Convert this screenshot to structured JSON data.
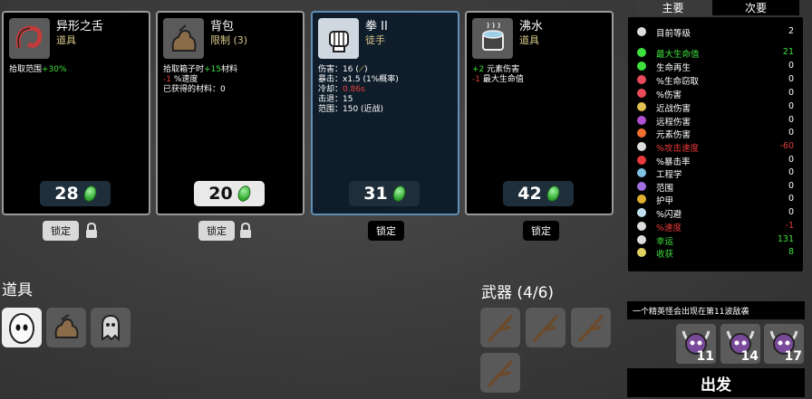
{
  "cards": [
    {
      "name": "异形之舌",
      "type": "道具",
      "lines": [
        {
          "parts": [
            {
              "t": "拾取范围",
              "c": "w"
            },
            {
              "t": "+30%",
              "c": "g"
            }
          ]
        }
      ],
      "price": "28",
      "price_style": "dark",
      "lock": "锁定",
      "lock_style": "light",
      "padlock": true
    },
    {
      "name": "背包",
      "type": "限制 (3)",
      "lines": [
        {
          "parts": [
            {
              "t": "拾取箱子时",
              "c": "w"
            },
            {
              "t": "+15",
              "c": "g"
            },
            {
              "t": "材料",
              "c": "w"
            }
          ]
        },
        {
          "parts": [
            {
              "t": "-1",
              "c": "r"
            },
            {
              "t": " %速度",
              "c": "w"
            }
          ]
        },
        {
          "parts": [
            {
              "t": "已获得的材料：0",
              "c": "w"
            }
          ]
        }
      ],
      "price": "20",
      "price_style": "light",
      "lock": "锁定",
      "lock_style": "light",
      "padlock": true
    },
    {
      "name": "拳 II",
      "type": "徒手",
      "lines": [
        {
          "parts": [
            {
              "t": "伤害：16 (",
              "c": "w"
            },
            {
              "t": "⟋",
              "c": "y"
            },
            {
              "t": ")",
              "c": "w"
            }
          ]
        },
        {
          "parts": [
            {
              "t": "暴击：x1.5 (1%概率)",
              "c": "w"
            }
          ]
        },
        {
          "parts": [
            {
              "t": "冷却：",
              "c": "w"
            },
            {
              "t": "0.86s",
              "c": "r"
            }
          ]
        },
        {
          "parts": [
            {
              "t": "击退：15",
              "c": "w"
            }
          ]
        },
        {
          "parts": [
            {
              "t": "范围：150 (近战)",
              "c": "w"
            }
          ]
        }
      ],
      "price": "31",
      "price_style": "dark",
      "lock": "锁定",
      "lock_style": "black",
      "padlock": false
    },
    {
      "name": "沸水",
      "type": "道具",
      "lines": [
        {
          "parts": [
            {
              "t": "+2",
              "c": "g"
            },
            {
              "t": " 元素伤害",
              "c": "w"
            }
          ]
        },
        {
          "parts": [
            {
              "t": "-1",
              "c": "r"
            },
            {
              "t": " 最大生命值",
              "c": "w"
            }
          ]
        }
      ],
      "price": "42",
      "price_style": "dark",
      "lock": "锁定",
      "lock_style": "black",
      "padlock": false
    }
  ],
  "items_title": "道具",
  "weapons_title": "武器 (4/6)",
  "tabs": {
    "primary": "主要",
    "secondary": "次要"
  },
  "stats": [
    {
      "label": "目前等级",
      "value": "2",
      "color": "w",
      "icon": "level-icon"
    },
    {
      "label": "最大生命值",
      "value": "21",
      "color": "g",
      "icon": "heart-icon"
    },
    {
      "label": "生命再生",
      "value": "0",
      "color": "w",
      "icon": "regen-icon"
    },
    {
      "label": "%生命窃取",
      "value": "0",
      "color": "w",
      "icon": "lifesteal-icon"
    },
    {
      "label": "%伤害",
      "value": "0",
      "color": "w",
      "icon": "damage-icon"
    },
    {
      "label": "近战伤害",
      "value": "0",
      "color": "w",
      "icon": "melee-icon"
    },
    {
      "label": "远程伤害",
      "value": "0",
      "color": "w",
      "icon": "ranged-icon"
    },
    {
      "label": "元素伤害",
      "value": "0",
      "color": "w",
      "icon": "elemental-icon"
    },
    {
      "label": "%攻击速度",
      "value": "-60",
      "color": "r",
      "icon": "attack-speed-icon"
    },
    {
      "label": "%暴击率",
      "value": "0",
      "color": "w",
      "icon": "crit-icon"
    },
    {
      "label": "工程学",
      "value": "0",
      "color": "w",
      "icon": "engineering-icon"
    },
    {
      "label": "范围",
      "value": "0",
      "color": "w",
      "icon": "range-icon"
    },
    {
      "label": "护甲",
      "value": "0",
      "color": "w",
      "icon": "armor-icon"
    },
    {
      "label": "%闪避",
      "value": "0",
      "color": "w",
      "icon": "dodge-icon"
    },
    {
      "label": "%速度",
      "value": "-1",
      "color": "r",
      "icon": "speed-icon"
    },
    {
      "label": "幸运",
      "value": "131",
      "color": "g",
      "icon": "luck-icon"
    },
    {
      "label": "收获",
      "value": "8",
      "color": "g",
      "icon": "harvest-icon"
    }
  ],
  "notice": "一个精英怪会出现在第11波敌袭",
  "waves": [
    "11",
    "14",
    "17"
  ],
  "go_label": "出发",
  "colors": {
    "green": "#3ee03e",
    "red": "#e83a3a",
    "card_border": "#9a9a9a",
    "selected_border": "#5f8fb5"
  }
}
